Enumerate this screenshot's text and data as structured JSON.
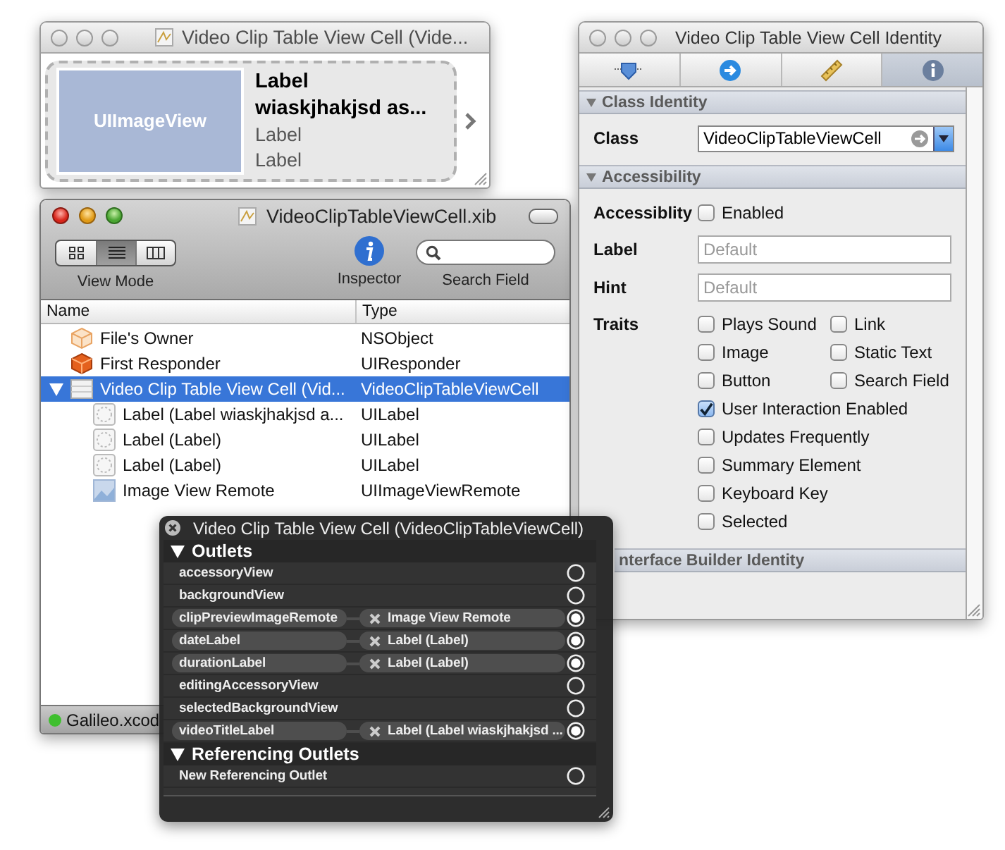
{
  "preview_window": {
    "title": "Video Clip Table View Cell (Vide...",
    "image_view": "UIImageView",
    "title_label": "Label\nwiaskjhakjsd as...",
    "labels": [
      "Label",
      "Label"
    ]
  },
  "xib_window": {
    "title": "VideoClipTableViewCell.xib",
    "view_modes": [
      {
        "kind": "icons",
        "selected": false
      },
      {
        "kind": "list",
        "selected": true
      },
      {
        "kind": "columns",
        "selected": false
      }
    ],
    "view_mode_label": "View Mode",
    "inspector_label": "Inspector",
    "search": {
      "label": "Search Field"
    },
    "columns": [
      "Name",
      "Type"
    ],
    "rows": [
      {
        "kind": "owner",
        "name": "File's Owner",
        "type": "NSObject",
        "selected": false
      },
      {
        "kind": "responder",
        "name": "First Responder",
        "type": "UIResponder",
        "selected": false
      },
      {
        "kind": "cell",
        "name": "Video Clip Table View Cell (Vid...",
        "type": "VideoClipTableViewCell",
        "selected": true,
        "expanded": true,
        "children": [
          {
            "kind": "label",
            "name": "Label (Label wiaskjhakjsd a...",
            "type": "UILabel",
            "selected": false
          },
          {
            "kind": "label",
            "name": "Label (Label)",
            "type": "UILabel",
            "selected": false
          },
          {
            "kind": "label",
            "name": "Label (Label)",
            "type": "UILabel",
            "selected": false
          },
          {
            "kind": "image",
            "name": "Image View Remote",
            "type": "UIImageViewRemote",
            "selected": false
          }
        ]
      }
    ],
    "status": "Galileo.xcod"
  },
  "inspector": {
    "title": "Video Clip Table View Cell Identity",
    "tabs": [
      {
        "kind": "attributes",
        "selected": false
      },
      {
        "kind": "connections",
        "selected": false
      },
      {
        "kind": "size",
        "selected": false
      },
      {
        "kind": "identity",
        "selected": true
      }
    ],
    "class_identity": {
      "header": "Class Identity",
      "expanded": true,
      "label": "Class",
      "value": "VideoClipTableViewCell"
    },
    "accessibility": {
      "header": "Accessibility",
      "expanded": true,
      "accessibility_label": "Accessiblity",
      "enabled": {
        "label": "Enabled",
        "checked": false
      },
      "fields": [
        {
          "label": "Label",
          "placeholder": "Default"
        },
        {
          "label": "Hint",
          "placeholder": "Default"
        }
      ],
      "traits_label": "Traits",
      "traits": [
        {
          "label": "Plays Sound",
          "checked": false
        },
        {
          "label": "Link",
          "checked": false
        },
        {
          "label": "Image",
          "checked": false
        },
        {
          "label": "Static Text",
          "checked": false
        },
        {
          "label": "Button",
          "checked": false
        },
        {
          "label": "Search Field",
          "checked": false
        },
        {
          "label": "User Interaction Enabled",
          "checked": true
        },
        {
          "label": "Updates Frequently",
          "checked": false
        },
        {
          "label": "Summary Element",
          "checked": false
        },
        {
          "label": "Keyboard Key",
          "checked": false
        },
        {
          "label": "Selected",
          "checked": false
        }
      ]
    },
    "ib_identity": {
      "header": "nterface Builder Identity"
    }
  },
  "connections_panel": {
    "title": "Video Clip Table View Cell (VideoClipTableViewCell)",
    "sections": [
      {
        "title": "Outlets",
        "expanded": true,
        "items": [
          {
            "name": "accessoryView",
            "connected": false
          },
          {
            "name": "backgroundView",
            "connected": false
          },
          {
            "name": "clipPreviewImageRemote",
            "connected": true,
            "target": "Image View Remote"
          },
          {
            "name": "dateLabel",
            "connected": true,
            "target": "Label (Label)"
          },
          {
            "name": "durationLabel",
            "connected": true,
            "target": "Label (Label)"
          },
          {
            "name": "editingAccessoryView",
            "connected": false
          },
          {
            "name": "selectedBackgroundView",
            "connected": false
          },
          {
            "name": "videoTitleLabel",
            "connected": true,
            "target": "Label (Label wiaskjhakjsd ..."
          }
        ]
      },
      {
        "title": "Referencing Outlets",
        "expanded": true,
        "items": [
          {
            "name": "New Referencing Outlet",
            "connected": false
          }
        ]
      }
    ]
  }
}
